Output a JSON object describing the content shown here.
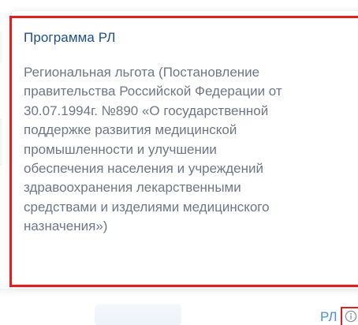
{
  "tooltip": {
    "title": "Программа РЛ",
    "body_lines": [
      "Региональная льгота (Постановление",
      "правительства Российской Федерации от",
      "30.07.1994г. №890 «О государственной",
      "поддержке развития медицинской",
      "промышленности и улучшении",
      "обеспечения населения и учреждений",
      "здравоохранения лекарственными",
      "средствами и изделиями медицинского",
      "назначения»)"
    ]
  },
  "field": {
    "value_label": "РЛ",
    "info_icon": "info-circle-icon"
  },
  "colors": {
    "title": "#1f4f8a",
    "body_text": "#6e7785",
    "highlight": "#e02020",
    "link": "#4a90d9"
  }
}
